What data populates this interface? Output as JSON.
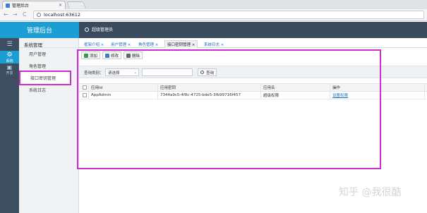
{
  "browser": {
    "tab_title": "管理后台",
    "tab_close": "×",
    "url": "localhost:63612",
    "nav": {
      "back": "←",
      "forward": "→",
      "reload": "C"
    }
  },
  "header": {
    "logo": "管理后台",
    "user": "超级管理员"
  },
  "iconbar": [
    {
      "icon": "menu-icon",
      "glyph": "☰",
      "label": ""
    },
    {
      "icon": "gear-icon",
      "glyph": "⚙",
      "label": "系统",
      "active": true
    },
    {
      "icon": "briefcase-icon",
      "glyph": "▣",
      "label": "开发"
    }
  ],
  "sidebar": {
    "section": "系统管理",
    "items": [
      {
        "label": "用户管理"
      },
      {
        "label": "角色管理"
      },
      {
        "label": "接口密钥管理",
        "highlighted": true
      },
      {
        "label": "系统日志"
      }
    ]
  },
  "page_tabs": [
    {
      "label": "框架介绍 ×"
    },
    {
      "label": "用户管理 ×"
    },
    {
      "label": "角色管理 ×"
    },
    {
      "label": "接口密钥管理 ×",
      "active": true
    },
    {
      "label": "系统日志 ×"
    }
  ],
  "toolbar": {
    "add": "添加",
    "edit": "修改",
    "delete": "删除"
  },
  "search": {
    "label": "查询类别：",
    "select_value": "请选择",
    "select_caret": "⌄",
    "query_button": "查询"
  },
  "grid": {
    "columns": [
      "应用Id",
      "应用密钥",
      "应用名",
      "操作"
    ],
    "rows": [
      {
        "app_id": "AppAdmin",
        "app_key": "7344a9c5-4f8c-4725-bde5-3fb99716f457",
        "app_name": "超级权限",
        "action": "设置权限"
      }
    ]
  },
  "watermark": "知乎 @我很酷",
  "colors": {
    "accent": "#1c9dd4",
    "header": "#394b5d",
    "highlight": "#c92fc9"
  }
}
